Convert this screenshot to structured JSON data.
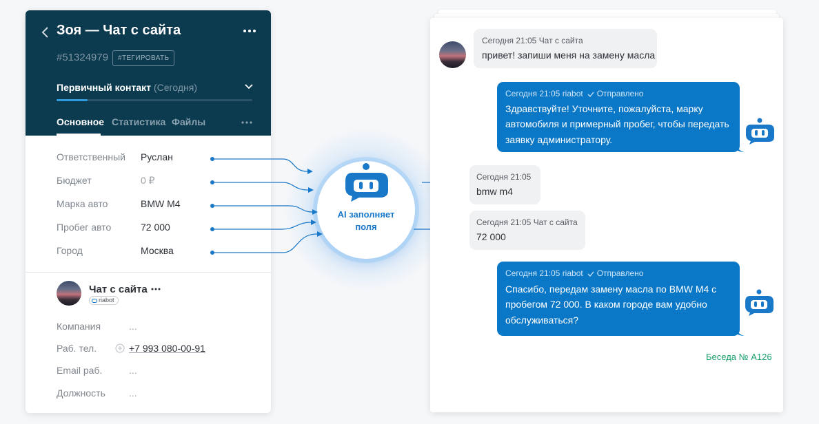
{
  "lead_card": {
    "title": "Зоя — Чат с сайта",
    "lead_id": "#51324979",
    "tag_button": "#ТЕГИРОВАТЬ",
    "pipeline_stage": "Первичный контакт",
    "pipeline_date": "(Сегодня)",
    "pipeline_progress": 0.16,
    "tabs": [
      "Основное",
      "Статистика",
      "Файлы"
    ],
    "fields": [
      {
        "label": "Ответственный",
        "value": "Руслан"
      },
      {
        "label": "Бюджет",
        "value": "0 ₽"
      },
      {
        "label": "Марка авто",
        "value": "BMW M4"
      },
      {
        "label": "Пробег авто",
        "value": "72 000"
      },
      {
        "label": "Город",
        "value": "Москва"
      }
    ],
    "contact": {
      "name": "Чат с сайта",
      "badge": "riabot",
      "fields": [
        {
          "label": "Компания",
          "value": "..."
        },
        {
          "label": "Раб. тел.",
          "value": "+7 993 080-00-91"
        },
        {
          "label": "Email раб.",
          "value": "..."
        },
        {
          "label": "Должность",
          "value": "..."
        }
      ]
    }
  },
  "ai_badge": {
    "label_line1": "AI заполняет",
    "label_line2": "поля"
  },
  "chat": {
    "messages": [
      {
        "direction": "in",
        "meta": "Сегодня 21:05 Чат с сайта",
        "lines": [
          "привет! запиши меня на замену масла"
        ]
      },
      {
        "direction": "out",
        "meta_time": "Сегодня 21:05 riabot",
        "status": "Отправлено",
        "lines": [
          "Здравствуйте! Уточните, пожалуйста, марку",
          "автомобиля и примерный пробег, чтобы передать",
          "заявку администратору."
        ]
      },
      {
        "direction": "in",
        "meta": "Сегодня 21:05",
        "lines": [
          "bmw m4"
        ]
      },
      {
        "direction": "in",
        "meta": "Сегодня 21:05 Чат с сайта",
        "lines": [
          "72 000"
        ]
      },
      {
        "direction": "out",
        "meta_time": "Сегодня 21:05 riabot",
        "status": "Отправлено",
        "lines": [
          "Спасибо, передам замену масла по BMW M4 с",
          "пробегом 72 000. В каком городе вам удобно",
          "обслуживаться?"
        ]
      }
    ],
    "conversation_label": "Беседа № А126"
  },
  "colors": {
    "header_bg": "#0c3a4e",
    "accent_blue": "#0a78c7",
    "ai_blue": "#1a78c9",
    "conversation_green": "#1aa06b"
  }
}
